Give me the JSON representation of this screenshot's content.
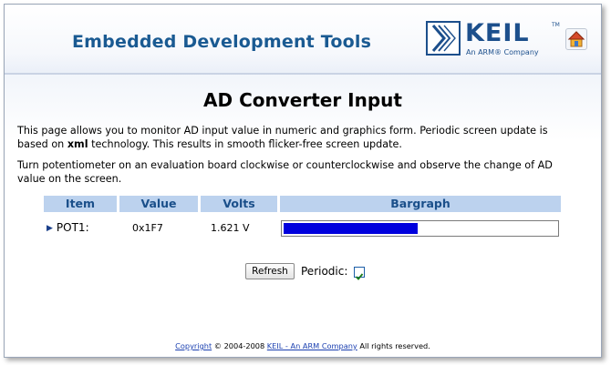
{
  "header": {
    "site_title": "Embedded Development Tools",
    "logo_text": "KEIL",
    "logo_tm": "TM",
    "logo_subtitle": "An ARM® Company",
    "home_icon": "home-icon"
  },
  "main": {
    "page_title": "AD Converter Input",
    "intro_before": "This page allows you to monitor AD input value in numeric and graphics form. Periodic screen update is based on ",
    "intro_bold": "xml",
    "intro_after": " technology. This results in smooth flicker-free screen update.",
    "instructions": "Turn potentiometer on an evaluation board clockwise or counterclockwise and observe the change of AD value on the screen."
  },
  "table": {
    "headers": [
      "Item",
      "Value",
      "Volts",
      "Bargraph"
    ],
    "rows": [
      {
        "item": "POT1:",
        "value": "0x1F7",
        "volts": "1.621 V",
        "bar_fraction": 0.491
      }
    ]
  },
  "controls": {
    "refresh_label": "Refresh",
    "periodic_label": "Periodic:",
    "periodic_checked": true
  },
  "footer": {
    "copyright_link": "Copyright",
    "copyright_text": " © 2004-2008 ",
    "company_link": "KEIL - An ARM Company",
    "rights": " All rights reserved."
  },
  "colors": {
    "title_blue": "#1a5a92",
    "header_band": "#bcd2ee",
    "bar_fill": "#0000dd",
    "link": "#1a3fb0"
  }
}
